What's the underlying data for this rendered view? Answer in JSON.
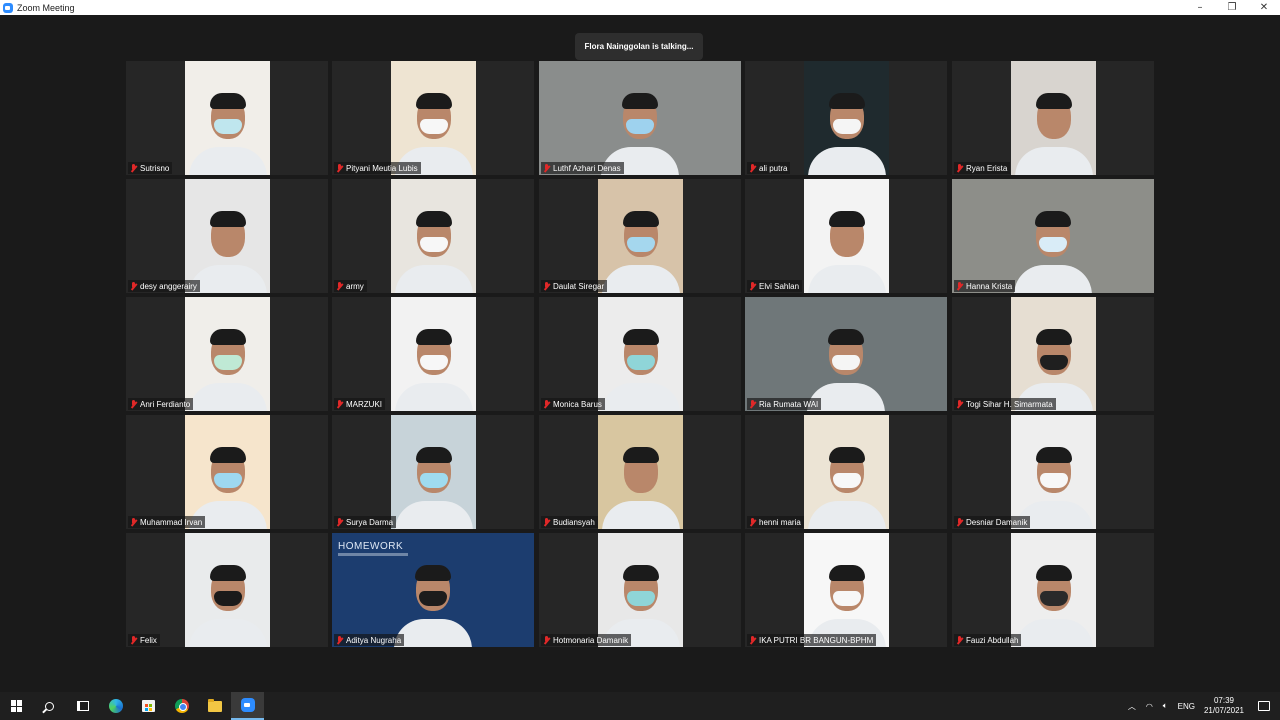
{
  "window": {
    "title": "Zoom Meeting",
    "controls": [
      "–",
      "❐",
      "✕"
    ]
  },
  "speaker": {
    "text": "Flora Nainggolan is talking..."
  },
  "participants": [
    {
      "name": "Sutrisno",
      "wide": false,
      "bg": "#f1eee9",
      "mask": "#bfe6ee"
    },
    {
      "name": "Pityani Meutia Lubis",
      "wide": false,
      "bg": "#eee4d2",
      "mask": "#f7f7f7"
    },
    {
      "name": "Luthf Azhari Denas",
      "wide": true,
      "bg": "#8a8d8c",
      "mask": "#9ed2ee"
    },
    {
      "name": "ali putra",
      "wide": false,
      "bg": "#1f2a2e",
      "mask": "#f5f5f5"
    },
    {
      "name": "Ryan Erista",
      "wide": false,
      "bg": "#d8d4cf",
      "mask": ""
    },
    {
      "name": "desy anggerairy",
      "wide": false,
      "bg": "#e6e6e6",
      "mask": ""
    },
    {
      "name": "army",
      "wide": false,
      "bg": "#e8e5df",
      "mask": "#f7f7f7"
    },
    {
      "name": "Daulat Siregar",
      "wide": false,
      "bg": "#d7c3a9",
      "mask": "#a5d7ee"
    },
    {
      "name": "Elvi Sahlan",
      "wide": false,
      "bg": "#f3f3f3",
      "mask": ""
    },
    {
      "name": "Hanna Krista",
      "wide": true,
      "bg": "#8d8e89",
      "mask": "#d9ecf7"
    },
    {
      "name": "Anri Ferdianto",
      "wide": false,
      "bg": "#f0eeea",
      "mask": "#bfe9d5"
    },
    {
      "name": "MARZUKI",
      "wide": false,
      "bg": "#f2f2f2",
      "mask": "#f7f7f7"
    },
    {
      "name": "Monica Barus",
      "wide": false,
      "bg": "#ececec",
      "mask": "#8fd5d8"
    },
    {
      "name": "Ria Rumata WAI",
      "wide": true,
      "bg": "#6f7779",
      "mask": "#f5f5f5"
    },
    {
      "name": "Togi Sihar H. Simarmata",
      "wide": false,
      "bg": "#e6ded2",
      "mask": "#1f1f1f"
    },
    {
      "name": "Muhammad Irvan",
      "wide": false,
      "bg": "#f6e5cc",
      "mask": "#9ed8f0"
    },
    {
      "name": "Surya Darma",
      "wide": false,
      "bg": "#c7d3d9",
      "mask": "#9fdbef"
    },
    {
      "name": "Budiansyah",
      "wide": false,
      "bg": "#d8c6a0",
      "mask": ""
    },
    {
      "name": "henni maria",
      "wide": false,
      "bg": "#ece4d5",
      "mask": "#f7f7f7"
    },
    {
      "name": "Desniar Damanik",
      "wide": false,
      "bg": "#eeeeee",
      "mask": "#f7f7f7"
    },
    {
      "name": "Felix",
      "wide": false,
      "bg": "#e9ebec",
      "mask": "#1a1a1a"
    },
    {
      "name": "Aditya Nugraha",
      "wide": true,
      "bg": "#1c3d6f",
      "mask": "#1c1c1c",
      "logo": "HOMEWORK"
    },
    {
      "name": "Hotmonaria Damanik",
      "wide": false,
      "bg": "#e8e8e8",
      "mask": "#8fd5d8"
    },
    {
      "name": "IKA PUTRI BR BANGUN-BPHM",
      "wide": false,
      "bg": "#f7f7f7",
      "mask": "#f7f7f7"
    },
    {
      "name": "Fauzi Abdullah",
      "wide": false,
      "bg": "#eeeeee",
      "mask": "#2a2a2a"
    }
  ],
  "taskbar": {
    "apps": [
      "start-icon",
      "search-icon",
      "taskview-icon",
      "edge-icon",
      "store-icon",
      "chrome-icon",
      "folder-icon",
      "zoom-icon"
    ],
    "language": "ENG",
    "time": "07:39",
    "date": "21/07/2021"
  }
}
